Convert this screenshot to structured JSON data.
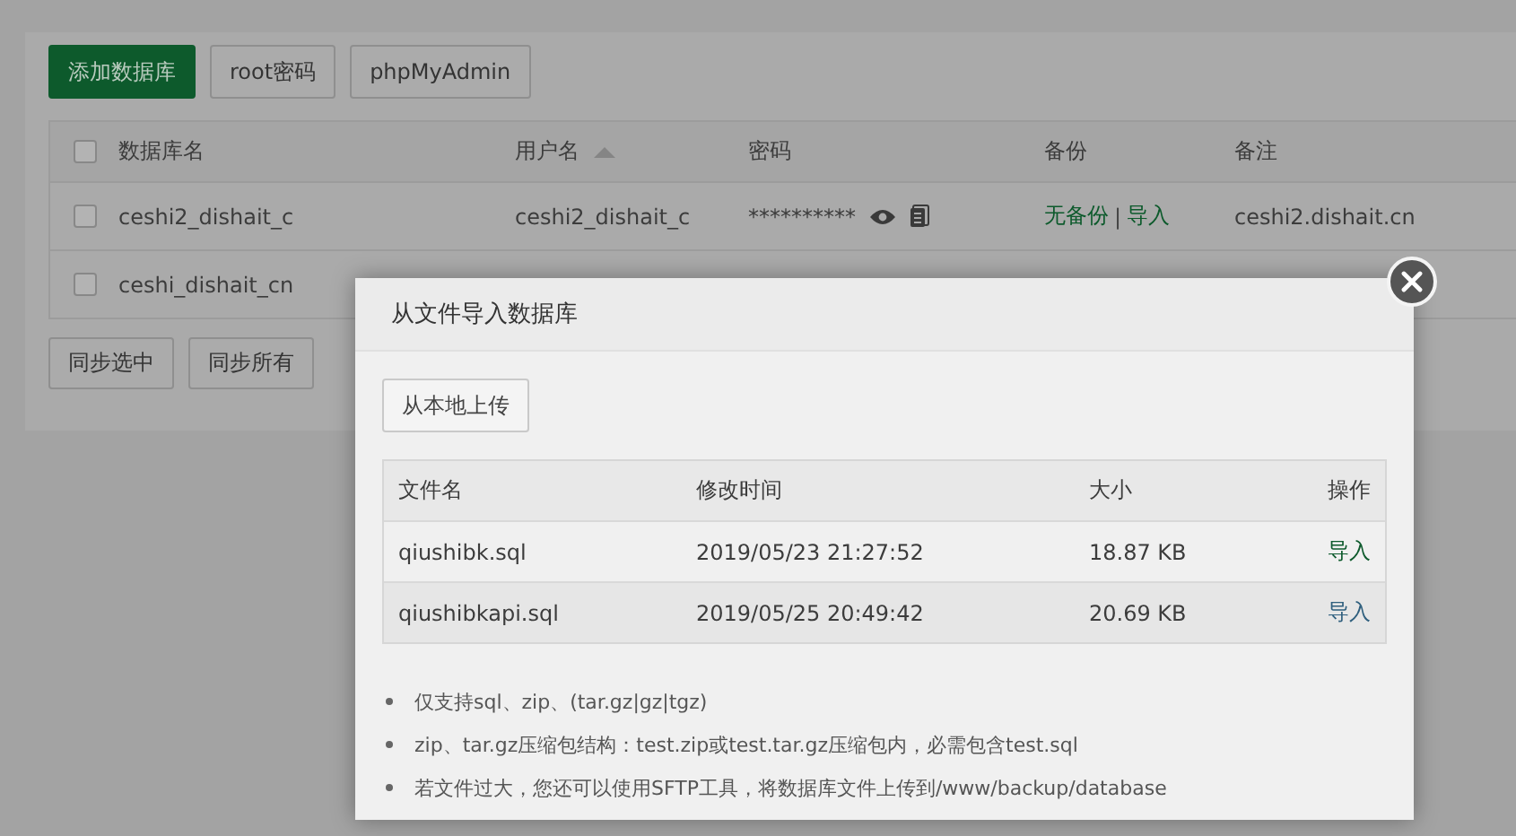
{
  "toolbar": {
    "buttons": [
      {
        "label": "添加数据库",
        "kind": "primary"
      },
      {
        "label": "root密码",
        "kind": "default"
      },
      {
        "label": "phpMyAdmin",
        "kind": "default"
      }
    ]
  },
  "db_table": {
    "header_checked": false,
    "columns": [
      {
        "label": "数据库名",
        "sorted": false
      },
      {
        "label": "用户名",
        "sorted": true
      },
      {
        "label": "密码",
        "sorted": false
      },
      {
        "label": "备份",
        "sorted": false
      },
      {
        "label": "备注",
        "sorted": false
      }
    ],
    "rows": [
      {
        "checked": false,
        "name": "ceshi2_dishait_c",
        "user": "ceshi2_dishait_c",
        "password": "**********",
        "backup": "无备份",
        "separator": "|",
        "import": "导入",
        "note": "ceshi2.dishait.cn"
      },
      {
        "checked": false,
        "name": "ceshi_dishait_cn"
      }
    ]
  },
  "footer_buttons": [
    "同步选中",
    "同步所有"
  ],
  "dialog": {
    "title": "从文件导入数据库",
    "upload_button": "从本地上传",
    "columns": [
      "文件名",
      "修改时间",
      "大小",
      "操作"
    ],
    "files": [
      {
        "name": "qiushibk.sql",
        "modified": "2019/05/23 21:27:52",
        "size": "18.87 KB",
        "action": "导入",
        "highlighted": false
      },
      {
        "name": "qiushibkapi.sql",
        "modified": "2019/05/25 20:49:42",
        "size": "20.69 KB",
        "action": "导入",
        "highlighted": true
      }
    ],
    "notes": [
      "仅支持sql、zip、(tar.gz|gz|tgz)",
      "zip、tar.gz压缩包结构：test.zip或test.tar.gz压缩包内，必需包含test.sql",
      "若文件过大，您还可以使用SFTP工具，将数据库文件上传到/www/backup/database"
    ]
  }
}
